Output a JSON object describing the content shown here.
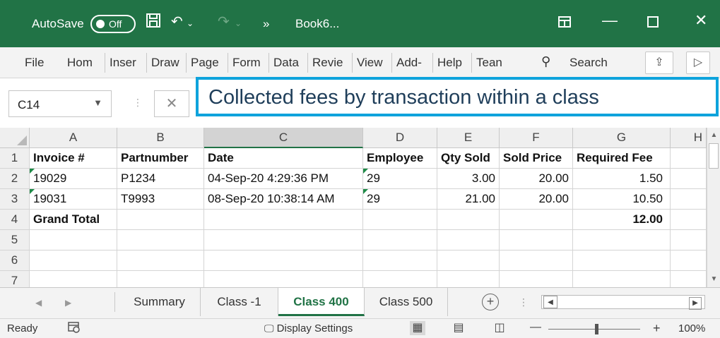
{
  "titlebar": {
    "autosave_label": "AutoSave",
    "toggle_state": "Off",
    "book_name": "Book6...",
    "more": "»"
  },
  "ribbon": {
    "tabs": [
      "File",
      "Hom",
      "Inser",
      "Draw",
      "Page",
      "Form",
      "Data",
      "Revie",
      "View",
      "Add-",
      "Help",
      "Tean"
    ],
    "search_label": "Search"
  },
  "formula_bar": {
    "name_box": "C14"
  },
  "callout": {
    "text": "Collected fees by transaction within a class",
    "border_color": "#0ea3dc"
  },
  "grid": {
    "columns": [
      "A",
      "B",
      "C",
      "D",
      "E",
      "F",
      "G",
      "H"
    ],
    "row_numbers": [
      "1",
      "2",
      "3",
      "4",
      "5",
      "6",
      "7"
    ],
    "rows": [
      [
        "Invoice #",
        "Partnumber",
        "Date",
        "Employee",
        "Qty Sold",
        "Sold Price",
        "Required Fee"
      ],
      [
        "19029",
        "P1234",
        "04-Sep-20 4:29:36 PM",
        "29",
        "3.00",
        "20.00",
        "1.50"
      ],
      [
        "19031",
        "T9993",
        "08-Sep-20 10:38:14 AM",
        "29",
        "21.00",
        "20.00",
        "10.50"
      ],
      [
        "Grand Total",
        "",
        "",
        "",
        "",
        "",
        "12.00"
      ],
      [
        "",
        "",
        "",
        "",
        "",
        "",
        ""
      ],
      [
        "",
        "",
        "",
        "",
        "",
        "",
        ""
      ],
      [
        "",
        "",
        "",
        "",
        "",
        "",
        ""
      ]
    ],
    "selected_column": "C"
  },
  "sheets": {
    "tabs": [
      "Summary",
      "Class -1",
      "Class 400",
      "Class 500"
    ],
    "active": "Class 400"
  },
  "status": {
    "ready": "Ready",
    "display_settings": "Display Settings",
    "zoom": "100%",
    "accent_color": "#217346"
  }
}
